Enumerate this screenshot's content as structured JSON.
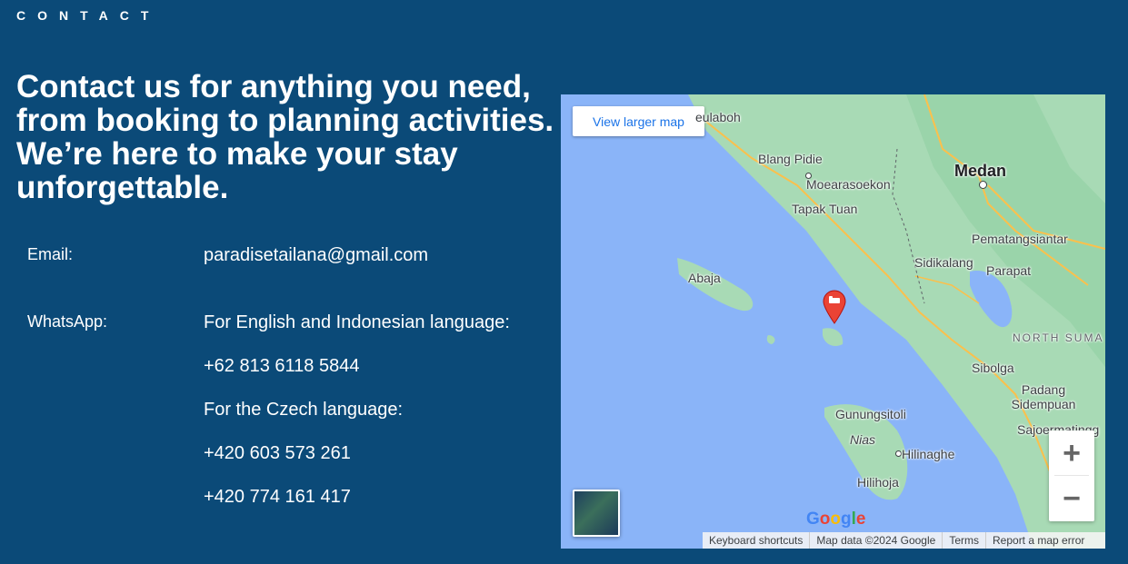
{
  "section": {
    "label": "CONTACT"
  },
  "headline": "Contact us for anything you need, from booking to planning activities. We’re here to make your stay unforgettable.",
  "contact": {
    "email_label": "Email:",
    "email_value": "paradisetailana@gmail.com",
    "whatsapp_label": "WhatsApp:",
    "whatsapp_lines": [
      "For English and Indonesian language:",
      "+62 813 6118 5844",
      "For the Czech language:",
      "+420 603 573 261",
      "+420 774 161 417"
    ]
  },
  "map": {
    "view_larger": "View larger map",
    "places": {
      "meulaboh": "eulaboh",
      "blang_pidie": "Blang Pidie",
      "moearasoekon": "Moearasoekon",
      "tapak_tuan": "Tapak Tuan",
      "medan": "Medan",
      "pematangsiantar": "Pematangsiantar",
      "sidikalang": "Sidikalang",
      "parapat": "Parapat",
      "abaja": "Abaja",
      "north_suma": "NORTH SUMA",
      "sibolga": "Sibolga",
      "padang_sidempuan": "Padang Sidempuan",
      "sajoermatinggi": "Sajoermatingg",
      "gunungsitoli": "Gunungsitoli",
      "nias": "Nias",
      "hilinaghe": "Hilinaghe",
      "hilihoja": "Hilihoja"
    },
    "zoom_in": "+",
    "zoom_out": "−",
    "logo": "Google",
    "footer": {
      "shortcuts": "Keyboard shortcuts",
      "map_data": "Map data ©2024 Google",
      "terms": "Terms",
      "report": "Report a map error"
    },
    "colors": {
      "water": "#8ab4f8",
      "land": "#a8dab5",
      "roads": "#fbc04c",
      "pin": "#ea4335"
    }
  }
}
